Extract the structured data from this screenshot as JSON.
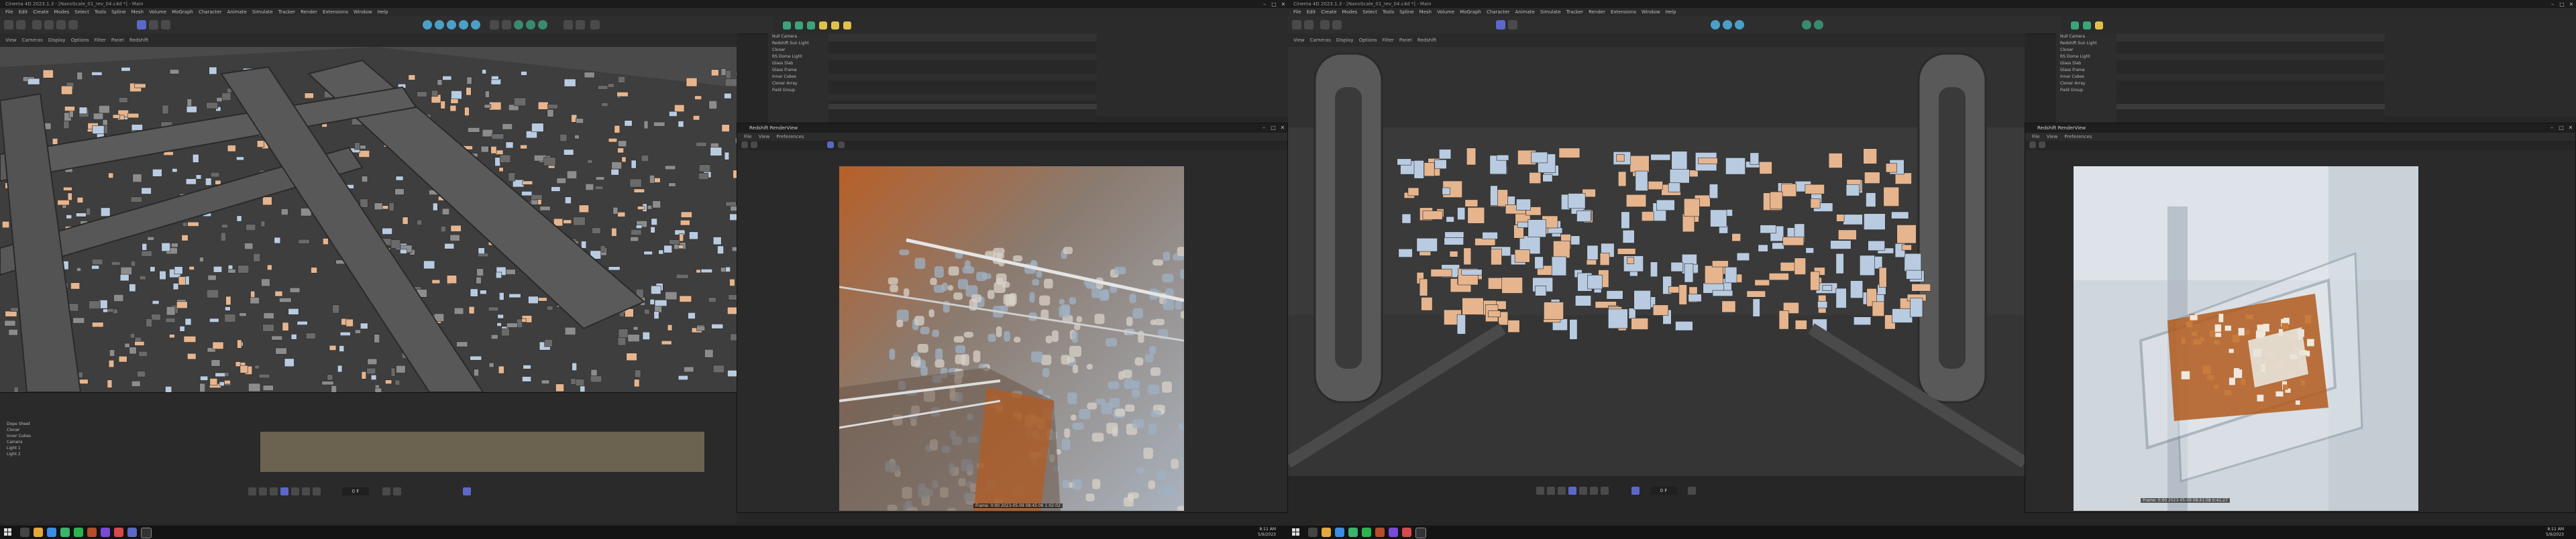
{
  "left": {
    "title_bar": "Cinema 4D 2023.1.3 - [NanoScale_01_rev_04.c4d *] - Main",
    "menu": [
      "File",
      "Edit",
      "Create",
      "Modes",
      "Select",
      "Tools",
      "Spline",
      "Mesh",
      "Volume",
      "MoGraph",
      "Character",
      "Animate",
      "Simulate",
      "Tracker",
      "Render",
      "Extensions",
      "Window",
      "Help"
    ],
    "viewport_menu": [
      "View",
      "Cameras",
      "Display",
      "Options",
      "Filter",
      "Panel",
      "Redshift"
    ],
    "objects_panel": [
      "Null Camera",
      "Redshift Sun Light",
      "Cloner",
      "RS Dome Light",
      "Glass Slab",
      "Glass Frame",
      "Inner Cubes",
      "Cloner Array",
      "Field Group"
    ],
    "render_view": {
      "title": "Redshift RenderView",
      "menu": [
        "File",
        "View",
        "Preferences"
      ],
      "stat": "Frame: 0:00  2023-05-09 08:45:06  1:02:02"
    },
    "timeline_rows": [
      "Dope Sheet",
      "Cloner",
      "Inner Cubes",
      "Camera",
      "Light 1",
      "Light 2"
    ],
    "frame_field": "0 F",
    "time": "8:11 AM",
    "date": "5/9/2023"
  },
  "right": {
    "title_bar": "Cinema 4D 2023.1.3 - [NanoScale_01_rev_04.c4d *] - Main",
    "menu": [
      "File",
      "Edit",
      "Create",
      "Modes",
      "Select",
      "Tools",
      "Spline",
      "Mesh",
      "Volume",
      "MoGraph",
      "Character",
      "Animate",
      "Simulate",
      "Tracker",
      "Render",
      "Extensions",
      "Window",
      "Help"
    ],
    "viewport_menu": [
      "View",
      "Cameras",
      "Display",
      "Options",
      "Filter",
      "Panel",
      "Redshift"
    ],
    "objects_panel": [
      "Null Camera",
      "Redshift Sun Light",
      "Cloner",
      "RS Dome Light",
      "Glass Slab",
      "Glass Frame",
      "Inner Cubes",
      "Cloner Array",
      "Field Group"
    ],
    "render_view": {
      "title": "Redshift RenderView",
      "menu": [
        "File",
        "View",
        "Preferences"
      ],
      "stat": "Frame: 0:00  2023-05-09 08:41:58  0:41:27"
    },
    "frame_field": "0 F",
    "time": "8:11 AM",
    "date": "5/9/2023"
  },
  "colors": {
    "accent": "#5b68c7",
    "teal": "#3a8b6e",
    "orange_glow": "#c8611d",
    "blue_glass": "#b9cbe0",
    "peach_box": "#e6b58e",
    "dark_grey": "#3d3d3d"
  }
}
